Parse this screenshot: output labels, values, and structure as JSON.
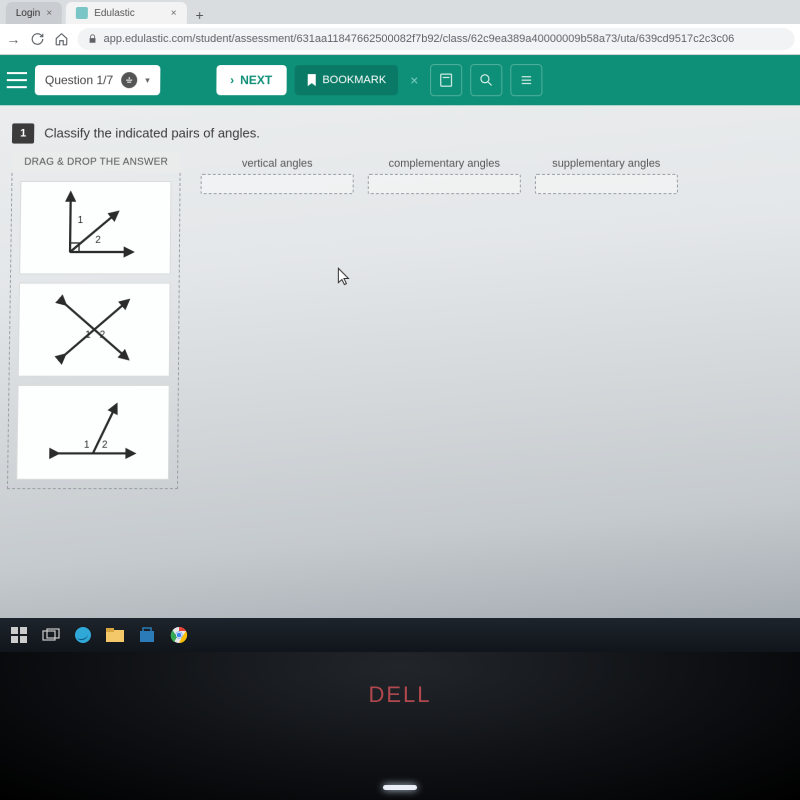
{
  "browser": {
    "tab_inactive": "Login",
    "tab_active": "Edulastic",
    "url": "app.edulastic.com/student/assessment/631aa11847662500082f7b92/class/62c9ea389a40000009b58a73/uta/639cd9517c2c3c06"
  },
  "toolbar": {
    "question_pill": "Question 1/7",
    "next_label": "NEXT",
    "bookmark_label": "BOOKMARK"
  },
  "question": {
    "number": "1",
    "prompt": "Classify the indicated pairs of angles.",
    "drag_header": "DRAG & DROP THE ANSWER",
    "tiles": [
      {
        "label1": "1",
        "label2": "2"
      },
      {
        "label1": "1",
        "label2": "2"
      },
      {
        "label1": "1",
        "label2": "2"
      }
    ],
    "drop_labels": [
      "vertical angles",
      "complementary angles",
      "supplementary angles"
    ]
  },
  "device": {
    "brand": "DELL"
  }
}
